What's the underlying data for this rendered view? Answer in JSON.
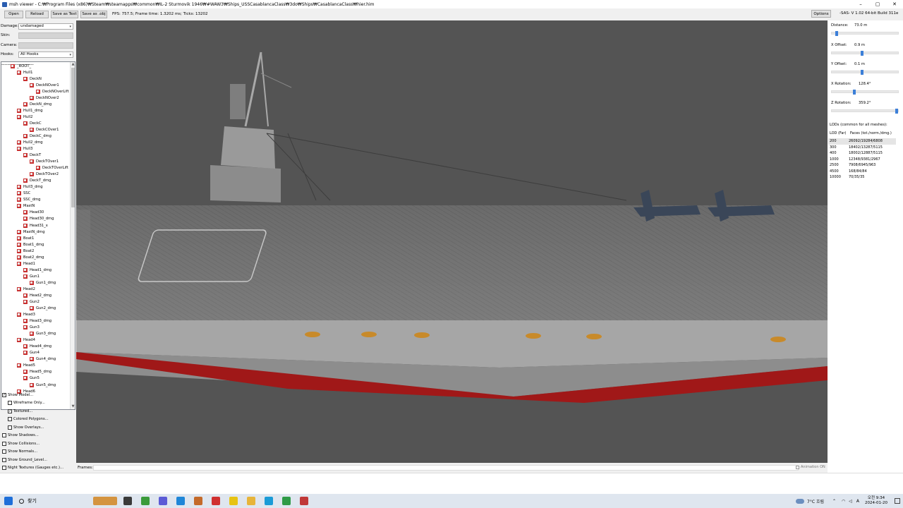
{
  "window": {
    "title": "msh viewer - C:₩Program Files (x86)₩Steam₩steamapps₩common₩IL-2 Sturmovik 1946₩#WAW3₩Ships_USSCasablancaClass₩3do₩Ships₩CasablancaClass₩hier.him",
    "minimize": "–",
    "maximize": "▢",
    "close": "✕"
  },
  "toolbar": {
    "open": "Open",
    "reload": "Reload",
    "save_text": "Save as Text",
    "save_obj": "Save as .obj",
    "status": "FPS: 757.5; Frame time: 1.3202 ms; Ticks: 13202",
    "options": "Options",
    "version": "-SAS- V 1.02 64-bit Build 311e"
  },
  "left": {
    "damage_label": "Damage:",
    "damage_value": "undamaged",
    "skin_label": "Skin:",
    "camera_label": "Camera:",
    "hooks_label": "Hooks:",
    "hooks_value": "All Hooks",
    "tree": [
      {
        "label": "_ROOT_",
        "level": 0,
        "exp": "-"
      },
      {
        "label": "Hull1",
        "level": 1,
        "exp": "-"
      },
      {
        "label": "DeckN",
        "level": 2,
        "exp": "-"
      },
      {
        "label": "DeckNOver1",
        "level": 3,
        "exp": "-"
      },
      {
        "label": "DeckNOverLift",
        "level": 4,
        "exp": ""
      },
      {
        "label": "DeckNOver2",
        "level": 3,
        "exp": ""
      },
      {
        "label": "DeckN_dmg",
        "level": 2,
        "exp": ""
      },
      {
        "label": "Hull1_dmg",
        "level": 1,
        "exp": ""
      },
      {
        "label": "Hull2",
        "level": 1,
        "exp": "-"
      },
      {
        "label": "DeckC",
        "level": 2,
        "exp": "-"
      },
      {
        "label": "DeckCOver1",
        "level": 3,
        "exp": ""
      },
      {
        "label": "DeckC_dmg",
        "level": 2,
        "exp": ""
      },
      {
        "label": "Hull2_dmg",
        "level": 1,
        "exp": ""
      },
      {
        "label": "Hull3",
        "level": 1,
        "exp": "-"
      },
      {
        "label": "DeckT",
        "level": 2,
        "exp": "-"
      },
      {
        "label": "DeckTOver1",
        "level": 3,
        "exp": "-"
      },
      {
        "label": "DeckTOverLift",
        "level": 4,
        "exp": ""
      },
      {
        "label": "DeckTOver2",
        "level": 3,
        "exp": ""
      },
      {
        "label": "DeckT_dmg",
        "level": 2,
        "exp": ""
      },
      {
        "label": "Hull3_dmg",
        "level": 1,
        "exp": ""
      },
      {
        "label": "SSC",
        "level": 1,
        "exp": ""
      },
      {
        "label": "SSC_dmg",
        "level": 1,
        "exp": ""
      },
      {
        "label": "MastN",
        "level": 1,
        "exp": "-"
      },
      {
        "label": "Head30",
        "level": 2,
        "exp": ""
      },
      {
        "label": "Head30_dmg",
        "level": 2,
        "exp": ""
      },
      {
        "label": "Head31_x",
        "level": 2,
        "exp": ""
      },
      {
        "label": "MastN_dmg",
        "level": 1,
        "exp": ""
      },
      {
        "label": "Boat1",
        "level": 1,
        "exp": ""
      },
      {
        "label": "Boat1_dmg",
        "level": 1,
        "exp": ""
      },
      {
        "label": "Boat2",
        "level": 1,
        "exp": ""
      },
      {
        "label": "Boat2_dmg",
        "level": 1,
        "exp": ""
      },
      {
        "label": "Head1",
        "level": 1,
        "exp": "-"
      },
      {
        "label": "Head1_dmg",
        "level": 2,
        "exp": ""
      },
      {
        "label": "Gun1",
        "level": 2,
        "exp": "-"
      },
      {
        "label": "Gun1_dmg",
        "level": 3,
        "exp": ""
      },
      {
        "label": "Head2",
        "level": 1,
        "exp": "-"
      },
      {
        "label": "Head2_dmg",
        "level": 2,
        "exp": ""
      },
      {
        "label": "Gun2",
        "level": 2,
        "exp": "-"
      },
      {
        "label": "Gun2_dmg",
        "level": 3,
        "exp": ""
      },
      {
        "label": "Head3",
        "level": 1,
        "exp": "-"
      },
      {
        "label": "Head3_dmg",
        "level": 2,
        "exp": ""
      },
      {
        "label": "Gun3",
        "level": 2,
        "exp": "-"
      },
      {
        "label": "Gun3_dmg",
        "level": 3,
        "exp": ""
      },
      {
        "label": "Head4",
        "level": 1,
        "exp": "-"
      },
      {
        "label": "Head4_dmg",
        "level": 2,
        "exp": ""
      },
      {
        "label": "Gun4",
        "level": 2,
        "exp": "-"
      },
      {
        "label": "Gun4_dmg",
        "level": 3,
        "exp": ""
      },
      {
        "label": "Head5",
        "level": 1,
        "exp": "-"
      },
      {
        "label": "Head5_dmg",
        "level": 2,
        "exp": ""
      },
      {
        "label": "Gun5",
        "level": 2,
        "exp": "-"
      },
      {
        "label": "Gun5_dmg",
        "level": 3,
        "exp": ""
      },
      {
        "label": "Head6",
        "level": 1,
        "exp": "-"
      }
    ],
    "checkboxes": [
      {
        "label": "Show Model...",
        "checked": true,
        "indent": 0
      },
      {
        "label": "Wireframe Only...",
        "checked": false,
        "indent": 1
      },
      {
        "label": "Textured...",
        "checked": true,
        "indent": 1
      },
      {
        "label": "Colored Polygons...",
        "checked": false,
        "indent": 1
      },
      {
        "label": "Show Overlays...",
        "checked": false,
        "indent": 1
      },
      {
        "label": "Show Shadows...",
        "checked": false,
        "indent": 0
      },
      {
        "label": "Show Collisions...",
        "checked": false,
        "indent": 0
      },
      {
        "label": "Show Normals...",
        "checked": false,
        "indent": 0
      },
      {
        "label": "Show Ground_Level...",
        "checked": false,
        "indent": 0
      },
      {
        "label": "Night Textures (Gauges etc.)...",
        "checked": false,
        "indent": 0
      }
    ]
  },
  "right": {
    "sliders": [
      {
        "label": "Distance:",
        "value": "73.0 m",
        "fraction": 0.05
      },
      {
        "label": "X Offset:",
        "value": "0.9 m",
        "fraction": 0.45
      },
      {
        "label": "Y Offset:",
        "value": "0.1 m",
        "fraction": 0.45
      },
      {
        "label": "X Rotation:",
        "value": "128.4°",
        "fraction": 0.33
      },
      {
        "label": "Z Rotation:",
        "value": "359.2°",
        "fraction": 1.0
      }
    ],
    "lod_title": "LODs (common for all meshes):",
    "lod_col1": "LOD (Far)",
    "lod_col2": "Faces (tot./norm./dmg.)",
    "lods": [
      {
        "lod": "200",
        "faces": "26092/19284/6808"
      },
      {
        "lod": "300",
        "faces": "18402/13287/5115"
      },
      {
        "lod": "400",
        "faces": "18002/12887/5115"
      },
      {
        "lod": "1000",
        "faces": "12348/9381/2967"
      },
      {
        "lod": "2500",
        "faces": "7908/6945/963"
      },
      {
        "lod": "4500",
        "faces": "168/84/84"
      },
      {
        "lod": "10000",
        "faces": "70/35/35"
      }
    ]
  },
  "bottom": {
    "frames_label": "Frames:",
    "animation": "Animation ON"
  },
  "taskbar": {
    "search_placeholder": "찾기",
    "weather": "7°C 흐림",
    "time": "오전 9:34",
    "date": "2024-01-20",
    "lang": "A"
  },
  "colors": {
    "accent": "#3c7fd8",
    "hull_red": "#a01818",
    "deck": "#707070"
  }
}
